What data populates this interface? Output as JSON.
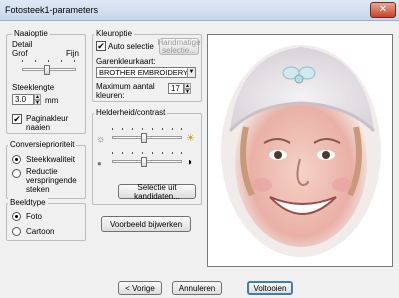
{
  "window": {
    "title": "Fotosteek1-parameters",
    "close_glyph": "✕"
  },
  "naaioptie": {
    "group_label": "Naaioptie",
    "detail_label": "Detail",
    "detail_min": "Grof",
    "detail_max": "Fijn",
    "detail_value": 0.45,
    "steeklengte_label": "Steeklengte",
    "steeklengte_value": "3.0",
    "steeklengte_unit": "mm",
    "paginakleur_label": "Paginakleur naaien",
    "paginakleur_checked": true
  },
  "conversieprioriteit": {
    "group_label": "Conversieprioriteit",
    "options": [
      "Steekkwaliteit",
      "Reductie verspringende steken"
    ],
    "selected": 0
  },
  "beeldtype": {
    "group_label": "Beeldtype",
    "options": [
      "Foto",
      "Cartoon"
    ],
    "selected": 0
  },
  "kleuroptie": {
    "group_label": "Kleuroptie",
    "auto_selectie_label": "Auto selectie",
    "auto_selectie_checked": true,
    "handmatige_button": "Handmatige selectie...",
    "garenkleurkaart_label": "Garenkleurkaart:",
    "garenkleurkaart_value": "BROTHER EMBROIDERY",
    "max_kleuren_label": "Maximum aantal kleuren:",
    "max_kleuren_value": "17"
  },
  "helderheid": {
    "group_label": "Helderheid/contrast",
    "brightness_value": 0.45,
    "contrast_value": 0.45,
    "kandidaten_button": "Selectie uit kandidaten..."
  },
  "voorbeeld_button": "Voorbeeld bijwerken",
  "footer": {
    "vorige": "< Vorige",
    "annuleren": "Annuleren",
    "voltooien": "Voltooien"
  },
  "icons": {
    "sun_dim": "☼",
    "sun_bright": "☀",
    "contrast_low": "●",
    "contrast_high": "◑",
    "dropdown": "▼",
    "spin_up": "▲",
    "spin_down": "▼"
  },
  "colors": {
    "titlebar": "#c6d6ea",
    "close": "#c7442a",
    "preview_bg": "#ffffff"
  }
}
